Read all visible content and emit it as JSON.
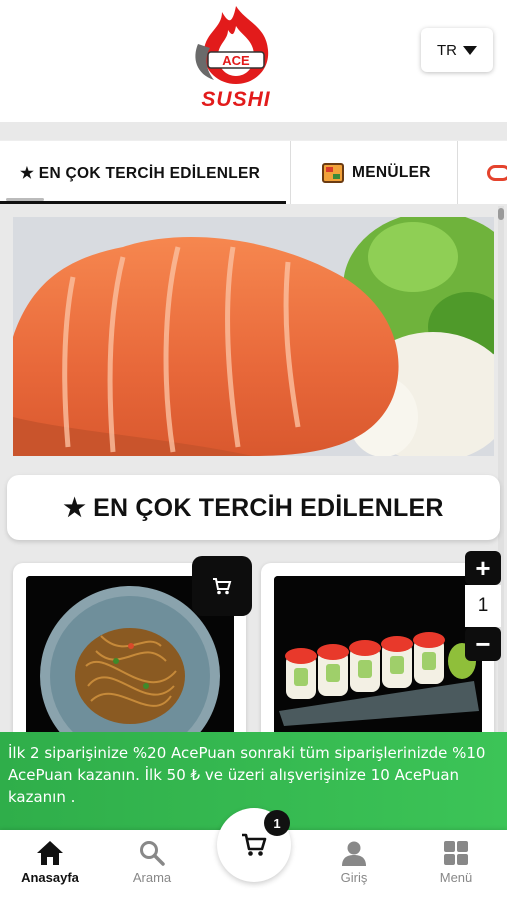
{
  "header": {
    "logo_text": "SUSHI",
    "logo_badge": "ACE",
    "language": "TR"
  },
  "tabs": [
    {
      "label": "★ EN ÇOK TERCİH EDİLENLER",
      "icon": "star-icon",
      "active": true
    },
    {
      "label": "MENÜLER",
      "icon": "menu-box-icon",
      "active": false
    },
    {
      "label": "",
      "icon": "sushi-icon",
      "active": false
    }
  ],
  "section": {
    "title": "★ EN ÇOK TERCİH EDİLENLER"
  },
  "products": [
    {
      "image": "noodles-plate",
      "has_cart_button": true
    },
    {
      "image": "sushi-roll-plate",
      "quantity": "1"
    }
  ],
  "stepper": {
    "plus": "+",
    "minus": "−",
    "value": "1"
  },
  "promo": {
    "text": "İlk 2 siparişinize %20 AcePuan sonraki tüm siparişlerinizde %10 AcePuan kazanın. İlk 50 ₺ ve üzeri alışverişinize 10 AcePuan kazanın ."
  },
  "cart": {
    "count": "1"
  },
  "bottom_nav": {
    "home": "Anasayfa",
    "search": "Arama",
    "login": "Giriş",
    "menu": "Menü"
  },
  "colors": {
    "brand_red": "#e21b1b",
    "promo_green": "#3cc457",
    "dark": "#0d0d0d"
  }
}
